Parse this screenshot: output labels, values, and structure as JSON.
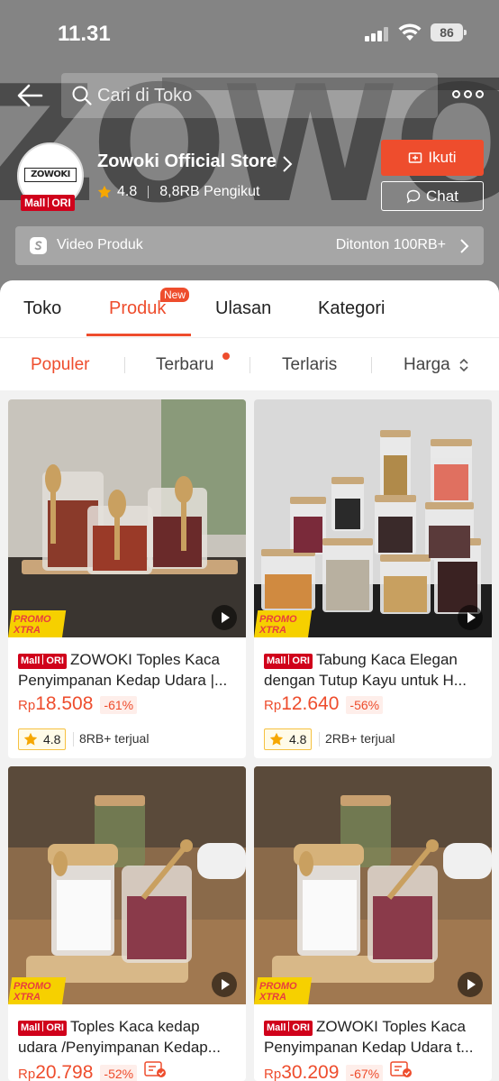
{
  "status_bar": {
    "time": "11.31",
    "battery": "86"
  },
  "header": {
    "banner_text": "ZOWOKI",
    "search_placeholder": "Cari di Toko"
  },
  "store": {
    "logo_text": "ZOWOKI",
    "mall_label": "Mall",
    "ori_label": "ORI",
    "name": "Zowoki Official Store",
    "rating": "4.8",
    "followers": "8,8RB Pengikut",
    "follow_label": "Ikuti",
    "chat_label": "Chat"
  },
  "video_bar": {
    "label": "Video Produk",
    "views": "Ditonton 100RB+"
  },
  "tabs": {
    "items": [
      {
        "label": "Toko"
      },
      {
        "label": "Produk"
      },
      {
        "label": "Ulasan"
      },
      {
        "label": "Kategori"
      }
    ],
    "new_badge": "New",
    "active_index": 1
  },
  "sort": {
    "items": [
      {
        "label": "Populer"
      },
      {
        "label": "Terbaru"
      },
      {
        "label": "Terlaris"
      },
      {
        "label": "Harga"
      }
    ],
    "active_index": 0
  },
  "promo": {
    "line1": "PROMO",
    "line2": "XTRA"
  },
  "products": [
    {
      "title": "ZOWOKI Toples Kaca Penyimpanan Kedap Udara |...",
      "currency": "Rp",
      "price": "18.508",
      "discount": "-61%",
      "rating": "4.8",
      "sold": "8RB+ terjual"
    },
    {
      "title": "Tabung Kaca Elegan dengan Tutup Kayu untuk H...",
      "currency": "Rp",
      "price": "12.640",
      "discount": "-56%",
      "rating": "4.8",
      "sold": "2RB+ terjual"
    },
    {
      "title": "Toples Kaca kedap udara /Penyimpanan Kedap...",
      "currency": "Rp",
      "price": "20.798",
      "discount": "-52%"
    },
    {
      "title": "ZOWOKI Toples Kaca Penyimpanan Kedap Udara t...",
      "currency": "Rp",
      "price": "30.209",
      "discount": "-67%"
    }
  ],
  "colors": {
    "accent": "#ee4d2d",
    "mall_red": "#d0011b",
    "promo_yellow": "#f6d000",
    "star": "#f6a700"
  }
}
